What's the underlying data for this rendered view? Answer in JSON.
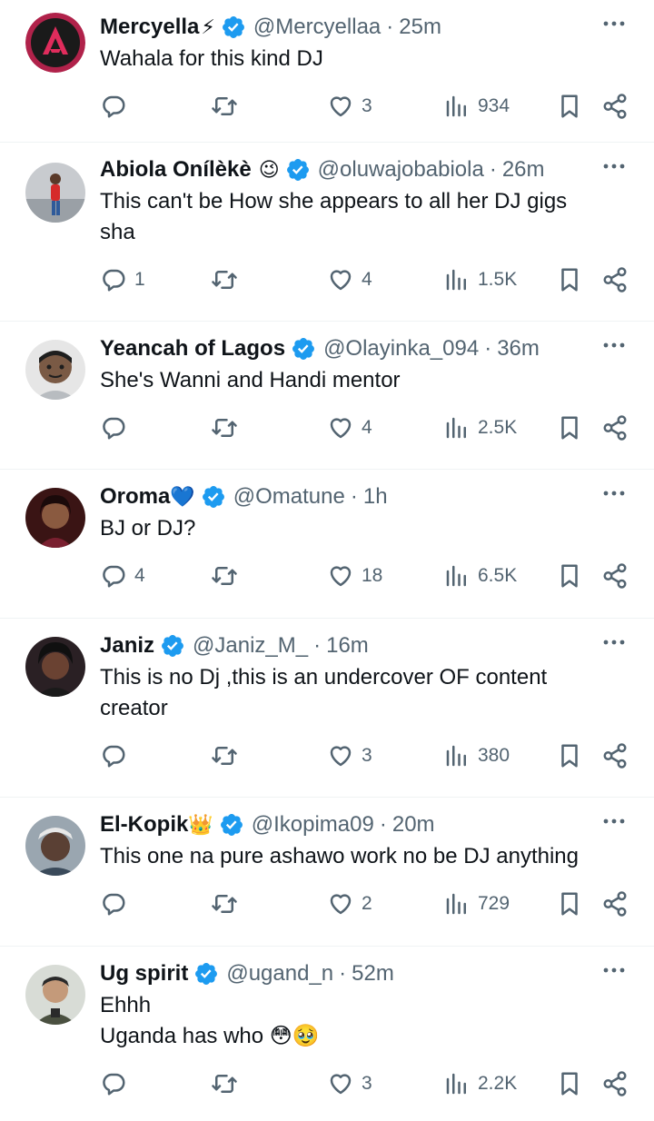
{
  "tweets": [
    {
      "name": "Mercyella",
      "emoji": "⚡",
      "handle": "@Mercyellaa",
      "time": "25m",
      "text": "Wahala for this kind DJ",
      "replies": "",
      "reposts": "",
      "likes": "3",
      "views": "934"
    },
    {
      "name": "Abiola Onílèkè",
      "emoji": "😉",
      "handle": "@oluwajobabiola",
      "time": "26m",
      "text": "This can't be How  she appears to all her  DJ gigs\nsha",
      "replies": "1",
      "reposts": "",
      "likes": "4",
      "views": "1.5K"
    },
    {
      "name": "Yeancah of Lagos",
      "emoji": "",
      "handle": "@Olayinka_094",
      "time": "36m",
      "text": "She's Wanni and Handi mentor",
      "replies": "",
      "reposts": "",
      "likes": "4",
      "views": "2.5K"
    },
    {
      "name": "Oroma",
      "emoji": "💙",
      "handle": "@Omatune",
      "time": "1h",
      "text": "BJ or DJ?",
      "replies": "4",
      "reposts": "",
      "likes": "18",
      "views": "6.5K"
    },
    {
      "name": "Janiz",
      "emoji": "",
      "handle": "@Janiz_M_",
      "time": "16m",
      "text": "This is no Dj ,this is an undercover OF content\ncreator",
      "replies": "",
      "reposts": "",
      "likes": "3",
      "views": "380"
    },
    {
      "name": "El-Kopik",
      "emoji": "👑",
      "handle": "@Ikopima09",
      "time": "20m",
      "text": "This one na pure ashawo work no be DJ anything",
      "replies": "",
      "reposts": "",
      "likes": "2",
      "views": "729"
    },
    {
      "name": "Ug spirit",
      "emoji": "",
      "handle": "@ugand_n",
      "time": "52m",
      "text": "Ehhh\nUganda has who 😳🥹",
      "replies": "",
      "reposts": "",
      "likes": "3",
      "views": "2.2K"
    }
  ],
  "icons": {
    "verified": "verified-badge-icon",
    "reply": "reply-icon",
    "repost": "repost-icon",
    "like": "heart-icon",
    "views": "views-icon",
    "bookmark": "bookmark-icon",
    "share": "share-icon",
    "more": "more-icon"
  },
  "colors": {
    "verified": "#1d9bf0",
    "muted": "#536471",
    "text": "#0f1419",
    "divider": "#eff3f4"
  }
}
